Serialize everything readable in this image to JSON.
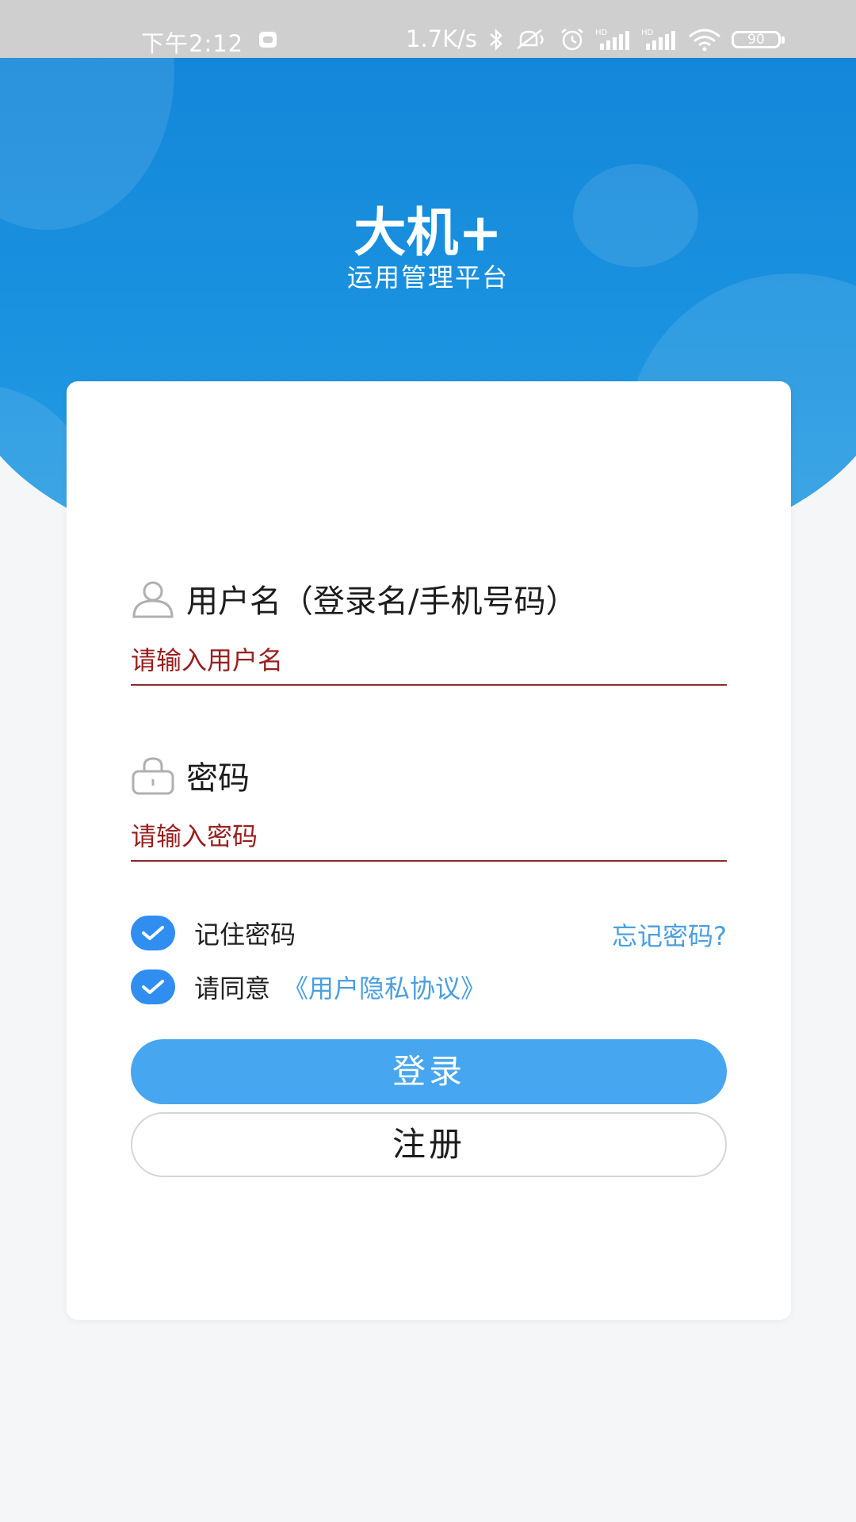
{
  "status_bar": {
    "time": "下午2:12",
    "net_speed": "1.7K/s",
    "battery": "90",
    "icons": [
      "bluetooth-icon",
      "mute-icon",
      "alarm-icon",
      "signal-hd-icon",
      "signal-hd-icon",
      "wifi-icon",
      "battery-icon"
    ]
  },
  "header": {
    "title": "大机+",
    "subtitle": "运用管理平台"
  },
  "form": {
    "username": {
      "label": "用户名（登录名/手机号码）",
      "placeholder": "请输入用户名",
      "value": "",
      "icon": "user-icon"
    },
    "password": {
      "label": "密码",
      "placeholder": "请输入密码",
      "value": "",
      "icon": "lock-icon"
    },
    "remember": {
      "label": "记住密码",
      "checked": true
    },
    "agree": {
      "label": "请同意",
      "link": "《用户隐私协议》",
      "checked": true
    },
    "forgot_link": "忘记密码?",
    "login_button": "登录",
    "register_button": "注册"
  },
  "colors": {
    "header_blue": "#1284d8",
    "accent": "#46a6ef",
    "link": "#4a9fe0",
    "placeholder_red": "#9a1f1f",
    "checkbox": "#2f8ef0"
  }
}
